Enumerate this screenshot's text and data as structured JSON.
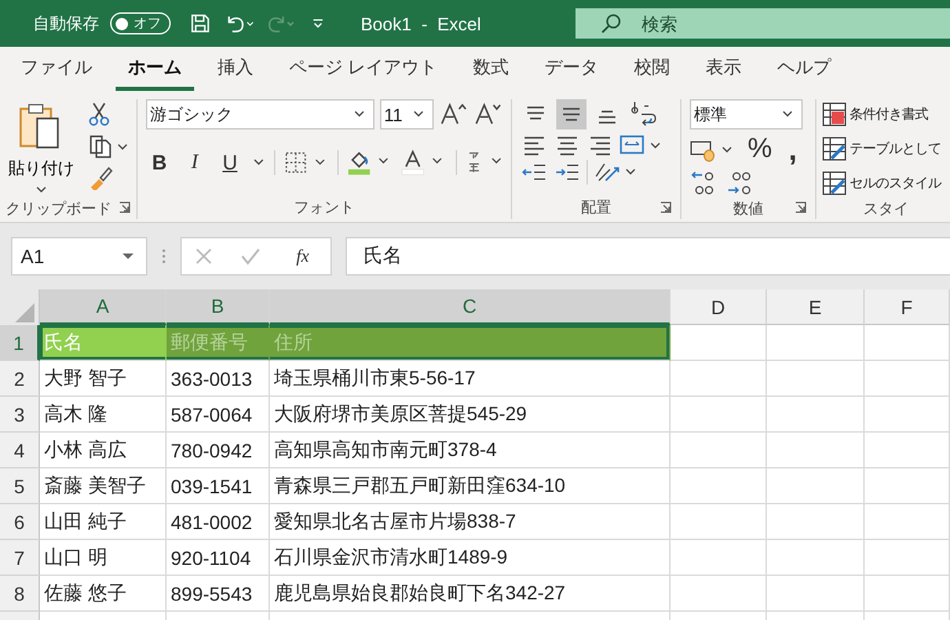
{
  "titlebar": {
    "autosave_label": "自動保存",
    "autosave": {
      "label": "オフ",
      "on": false
    },
    "redo": {
      "disabled": true
    },
    "title": "Book1  -  Excel",
    "search": {
      "placeholder": "検索"
    }
  },
  "tabs": [
    {
      "label": "ファイル",
      "selected": false
    },
    {
      "label": "ホーム",
      "selected": true
    },
    {
      "label": "挿入",
      "selected": false
    },
    {
      "label": "ページ レイアウト",
      "selected": false
    },
    {
      "label": "数式",
      "selected": false
    },
    {
      "label": "データ",
      "selected": false
    },
    {
      "label": "校閲",
      "selected": false
    },
    {
      "label": "表示",
      "selected": false
    },
    {
      "label": "ヘルプ",
      "selected": false
    }
  ],
  "ribbon": {
    "clipboard": {
      "paste": "貼り付け",
      "label": "クリップボード"
    },
    "font": {
      "name": "游ゴシック",
      "size": "11",
      "bold": "B",
      "italic": "I",
      "underline": "U",
      "label": "フォント"
    },
    "alignment": {
      "vertical": [
        {
          "selected": false
        },
        {
          "selected": true
        },
        {
          "selected": false
        }
      ],
      "label": "配置"
    },
    "number": {
      "format": "標準",
      "percent": "%",
      "comma": ",",
      "label": "数値"
    },
    "styles": {
      "items": [
        "条件付き書式",
        "テーブルとして",
        "セルのスタイル"
      ],
      "label": "スタイ"
    }
  },
  "formula_bar": {
    "name_box": "A1",
    "fx": "fx",
    "value": "氏名"
  },
  "columns": [
    {
      "label": "A",
      "selected": true
    },
    {
      "label": "B",
      "selected": true
    },
    {
      "label": "C",
      "selected": true
    },
    {
      "label": "D",
      "selected": false
    },
    {
      "label": "E",
      "selected": false
    },
    {
      "label": "F",
      "selected": false
    }
  ],
  "rows": [
    {
      "number": "1",
      "selected": true,
      "cells": [
        {
          "text": "氏名",
          "color": "#92d050",
          "muted": false
        },
        {
          "text": "郵便番号",
          "color": "#70a33c",
          "muted": true
        },
        {
          "text": "住所",
          "color": "#70a33c",
          "muted": true
        }
      ]
    },
    {
      "number": "2",
      "selected": false,
      "cells": [
        {
          "text": "大野 智子"
        },
        {
          "text": "363-0013"
        },
        {
          "text": "埼玉県桶川市東5-56-17"
        }
      ]
    },
    {
      "number": "3",
      "selected": false,
      "cells": [
        {
          "text": "高木 隆"
        },
        {
          "text": "587-0064"
        },
        {
          "text": "大阪府堺市美原区菩提545-29"
        }
      ]
    },
    {
      "number": "4",
      "selected": false,
      "cells": [
        {
          "text": "小林 高広"
        },
        {
          "text": "780-0942"
        },
        {
          "text": "高知県高知市南元町378-4"
        }
      ]
    },
    {
      "number": "5",
      "selected": false,
      "cells": [
        {
          "text": "斎藤 美智子"
        },
        {
          "text": "039-1541"
        },
        {
          "text": "青森県三戸郡五戸町新田窪634-10"
        }
      ]
    },
    {
      "number": "6",
      "selected": false,
      "cells": [
        {
          "text": "山田 純子"
        },
        {
          "text": "481-0002"
        },
        {
          "text": "愛知県北名古屋市片場838-7"
        }
      ]
    },
    {
      "number": "7",
      "selected": false,
      "cells": [
        {
          "text": "山口 明"
        },
        {
          "text": "920-1104"
        },
        {
          "text": "石川県金沢市清水町1489-9"
        }
      ]
    },
    {
      "number": "8",
      "selected": false,
      "cells": [
        {
          "text": "佐藤 悠子"
        },
        {
          "text": "899-5543"
        },
        {
          "text": "鹿児島県始良郡始良町下名342-27"
        }
      ]
    }
  ]
}
